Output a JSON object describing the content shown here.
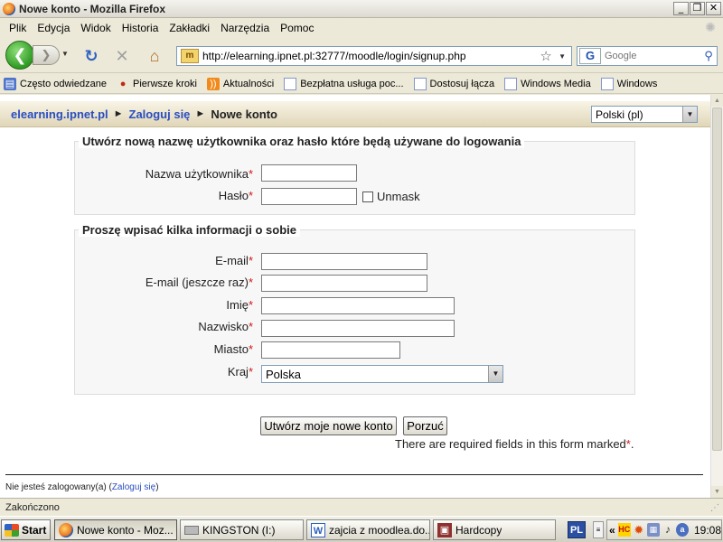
{
  "window": {
    "title": "Nowe konto - Mozilla Firefox"
  },
  "menu": [
    "Plik",
    "Edycja",
    "Widok",
    "Historia",
    "Zakładki",
    "Narzędzia",
    "Pomoc"
  ],
  "navbar": {
    "url": "http://elearning.ipnet.pl:32777/moodle/login/signup.php",
    "search_placeholder": "Google"
  },
  "bookmarks": [
    {
      "label": "Często odwiedzane",
      "icon": "folder-icon"
    },
    {
      "label": "Pierwsze kroki",
      "icon": "firefox-red-icon"
    },
    {
      "label": "Aktualności",
      "icon": "rss-icon"
    },
    {
      "label": "Bezpłatna usługa poc...",
      "icon": "page-icon"
    },
    {
      "label": "Dostosuj łącza",
      "icon": "page-icon"
    },
    {
      "label": "Windows Media",
      "icon": "page-icon"
    },
    {
      "label": "Windows",
      "icon": "page-icon"
    }
  ],
  "breadcrumb": {
    "site": "elearning.ipnet.pl",
    "login": "Zaloguj się",
    "current": "Nowe konto",
    "sep": "►"
  },
  "language": {
    "selected": "Polski (pl)"
  },
  "section1": {
    "legend": "Utwórz nową nazwę użytkownika oraz hasło które będą używane do logowania",
    "username_label": "Nazwa użytkownika",
    "password_label": "Hasło",
    "unmask_label": "Unmask"
  },
  "section2": {
    "legend": "Proszę wpisać kilka informacji o sobie",
    "email_label": "E-mail",
    "email2_label": "E-mail (jeszcze raz)",
    "firstname_label": "Imię",
    "lastname_label": "Nazwisko",
    "city_label": "Miasto",
    "country_label": "Kraj",
    "country_value": "Polska"
  },
  "required_star": "*",
  "buttons": {
    "submit": "Utwórz moje nowe konto",
    "cancel": "Porzuć"
  },
  "required_note": "There are required fields in this form marked",
  "footer": {
    "login_info_prefix": "Nie jesteś zalogowany(a) (",
    "login_link": "Zaloguj się",
    "login_info_suffix": ")"
  },
  "status": "Zakończono",
  "taskbar": {
    "start": "Start",
    "tasks": [
      "Nowe konto - Moz...",
      "KINGSTON (I:)",
      "zajcia z moodlea.do...",
      "Hardcopy"
    ],
    "lang": "PL",
    "clock": "19:08"
  },
  "colors": {
    "accent_link": "#2a4ec0",
    "required": "#d01616"
  }
}
